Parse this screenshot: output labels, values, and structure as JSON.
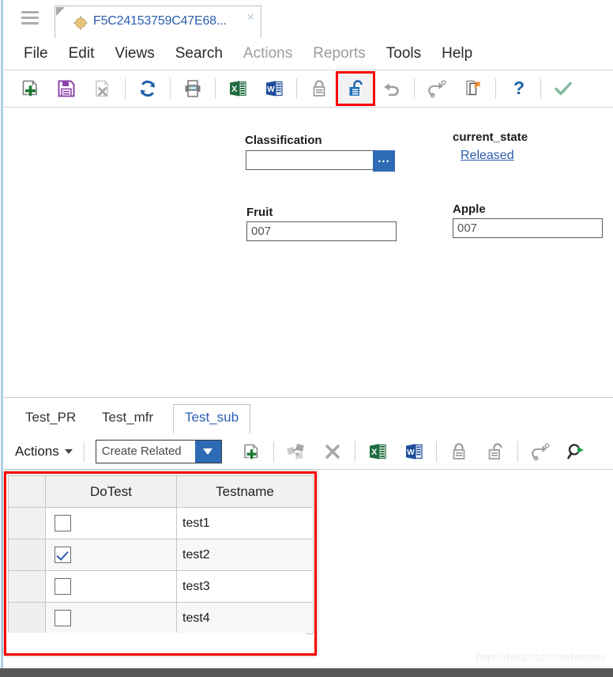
{
  "window": {
    "hamburger_icon": "hamburger-menu-icon",
    "tab": {
      "icon": "eclipse-document-icon",
      "title": "F5C24153759C47E68...",
      "close": "×"
    }
  },
  "menubar": {
    "items": [
      {
        "label": "File",
        "disabled": false
      },
      {
        "label": "Edit",
        "disabled": false
      },
      {
        "label": "Views",
        "disabled": false
      },
      {
        "label": "Search",
        "disabled": false
      },
      {
        "label": "Actions",
        "disabled": true
      },
      {
        "label": "Reports",
        "disabled": true
      },
      {
        "label": "Tools",
        "disabled": false
      },
      {
        "label": "Help",
        "disabled": false
      }
    ]
  },
  "toolbar": {
    "buttons": [
      {
        "name": "new-icon",
        "title": "New"
      },
      {
        "name": "save-icon",
        "title": "Save"
      },
      {
        "name": "delete-icon",
        "title": "Delete"
      },
      {
        "name": "refresh-icon",
        "title": "Refresh"
      },
      {
        "name": "print-icon",
        "title": "Print"
      },
      {
        "name": "export-excel-icon",
        "title": "Export to Excel"
      },
      {
        "name": "export-word-icon",
        "title": "Export to Word"
      },
      {
        "name": "lock-icon",
        "title": "Lock"
      },
      {
        "name": "unlock-icon",
        "title": "Unlock"
      },
      {
        "name": "undo-icon",
        "title": "Undo"
      },
      {
        "name": "redo-icon",
        "title": "Redo"
      },
      {
        "name": "copy-to-icon",
        "title": "Copy To"
      },
      {
        "name": "help-icon",
        "title": "Help"
      },
      {
        "name": "check-icon",
        "title": "Apply"
      }
    ],
    "highlighted_button": "unlock-icon",
    "highlight_color": "#f80000"
  },
  "form": {
    "classification": {
      "label": "Classification",
      "value": "",
      "placeholder": "",
      "picker_label": "..."
    },
    "current_state": {
      "label": "current_state",
      "value": "Released",
      "link_color": "#2a5db0"
    },
    "fruit": {
      "label": "Fruit",
      "value": "007"
    },
    "apple": {
      "label": "Apple",
      "value": "007"
    }
  },
  "subtabs": {
    "items": [
      {
        "label": "Test_PR",
        "active": false
      },
      {
        "label": "Test_mfr",
        "active": false
      },
      {
        "label": "Test_sub",
        "active": true
      }
    ]
  },
  "subtoolbar": {
    "actions_label": "Actions",
    "combo": {
      "value": "Create Related",
      "options": [
        "Create Related"
      ]
    },
    "buttons": [
      {
        "name": "add-row-icon",
        "title": "Add"
      },
      {
        "name": "structure-icon",
        "title": "Structure Browser"
      },
      {
        "name": "remove-icon",
        "title": "Remove"
      },
      {
        "name": "export-excel-icon",
        "title": "Export to Excel"
      },
      {
        "name": "export-word-icon",
        "title": "Export to Word"
      },
      {
        "name": "lock-icon",
        "title": "Lock"
      },
      {
        "name": "unlock-icon",
        "title": "Unlock"
      },
      {
        "name": "redo-icon",
        "title": "Redo"
      },
      {
        "name": "search-go-icon",
        "title": "Search"
      }
    ]
  },
  "grid": {
    "columns": [
      "",
      "DoTest",
      "Testname"
    ],
    "rows": [
      {
        "checked": false,
        "testname": "test1"
      },
      {
        "checked": true,
        "testname": "test2"
      },
      {
        "checked": false,
        "testname": "test3"
      },
      {
        "checked": false,
        "testname": "test4"
      }
    ],
    "highlight_color": "#f80000"
  },
  "watermark": "https://blog.csdn.net/hwytree"
}
